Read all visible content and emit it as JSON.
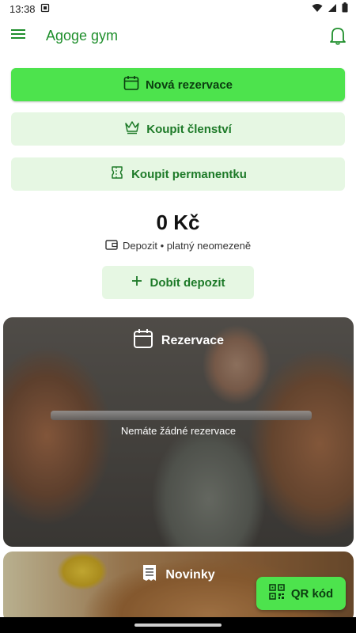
{
  "status_bar": {
    "time": "13:38"
  },
  "app_bar": {
    "title": "Agoge gym"
  },
  "actions": {
    "new_reservation": "Nová rezervace",
    "buy_membership": "Koupit členství",
    "buy_pass": "Koupit permanentku"
  },
  "deposit": {
    "amount": "0 Kč",
    "label": "Depozit • platný neomezeně",
    "topup_label": "Dobít depozit"
  },
  "reservations_card": {
    "title": "Rezervace",
    "empty_text": "Nemáte žádné rezervace"
  },
  "news_card": {
    "title": "Novinky"
  },
  "qr_button": {
    "label": "QR kód"
  },
  "colors": {
    "accent": "#4de34d",
    "accent_light": "#e6f7e3",
    "accent_text": "#1d7a28"
  }
}
